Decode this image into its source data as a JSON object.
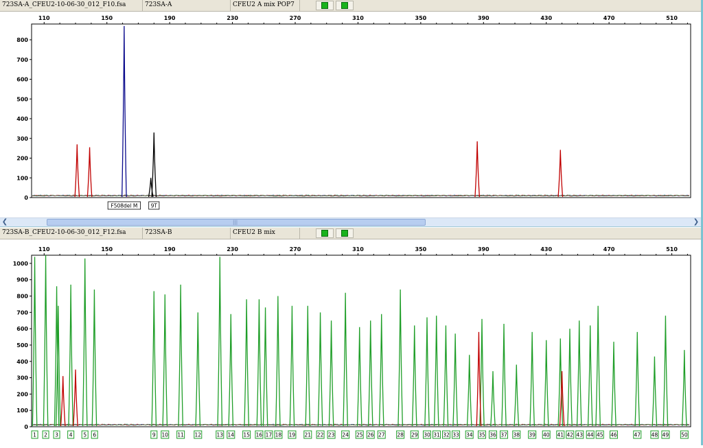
{
  "panels": [
    {
      "file": "723SA-A_CFEU2-10-06-30_012_F10.fsa",
      "sample": "723SA-A",
      "panel": "CFEU2 A mix POP7"
    },
    {
      "file": "723SA-B_CFEU2-10-06-30_012_F12.fsa",
      "sample": "723SA-B",
      "panel": "CFEU2 B mix"
    }
  ],
  "chart_data": [
    {
      "type": "line",
      "title": "",
      "xlabel": "",
      "ylabel": "",
      "xlim": [
        102,
        522
      ],
      "ylim": [
        0,
        880
      ],
      "x_ticks": [
        110,
        150,
        190,
        230,
        270,
        310,
        350,
        390,
        430,
        470,
        510
      ],
      "y_ticks": [
        0,
        100,
        200,
        300,
        400,
        500,
        600,
        700,
        800
      ],
      "grid": false,
      "series": [
        {
          "color": "#0a0a8c",
          "peaks": [
            {
              "x": 161,
              "y": 870
            }
          ]
        },
        {
          "color": "#000000",
          "peaks": [
            {
              "x": 180,
              "y": 330
            },
            {
              "x": 178,
              "y": 100
            }
          ]
        },
        {
          "color": "#c00000",
          "peaks": [
            {
              "x": 131,
              "y": 270
            },
            {
              "x": 139,
              "y": 255
            },
            {
              "x": 386,
              "y": 285
            },
            {
              "x": 439,
              "y": 242
            }
          ]
        }
      ],
      "annotations": [
        {
          "label": "F508del M",
          "x": 161
        },
        {
          "label": "9T",
          "x": 180
        }
      ]
    },
    {
      "type": "line",
      "title": "",
      "xlabel": "",
      "ylabel": "",
      "xlim": [
        102,
        522
      ],
      "ylim": [
        0,
        1050
      ],
      "x_ticks": [
        110,
        150,
        190,
        230,
        270,
        310,
        350,
        390,
        430,
        470,
        510
      ],
      "y_ticks": [
        0,
        100,
        200,
        300,
        400,
        500,
        600,
        700,
        800,
        900,
        1000
      ],
      "grid": false,
      "series": [
        {
          "color": "#1f9e28",
          "peaks": [
            {
              "x": 104,
              "y": 1040
            },
            {
              "x": 111,
              "y": 1050
            },
            {
              "x": 118,
              "y": 860
            },
            {
              "x": 119,
              "y": 740
            },
            {
              "x": 127,
              "y": 870
            },
            {
              "x": 136,
              "y": 1030
            },
            {
              "x": 142,
              "y": 840
            },
            {
              "x": 180,
              "y": 830
            },
            {
              "x": 187,
              "y": 810
            },
            {
              "x": 197,
              "y": 870
            },
            {
              "x": 208,
              "y": 700
            },
            {
              "x": 222,
              "y": 1040
            },
            {
              "x": 229,
              "y": 690
            },
            {
              "x": 239,
              "y": 780
            },
            {
              "x": 247,
              "y": 780
            },
            {
              "x": 251,
              "y": 730
            },
            {
              "x": 259,
              "y": 800
            },
            {
              "x": 268,
              "y": 740
            },
            {
              "x": 278,
              "y": 740
            },
            {
              "x": 286,
              "y": 700
            },
            {
              "x": 293,
              "y": 650
            },
            {
              "x": 302,
              "y": 820
            },
            {
              "x": 311,
              "y": 610
            },
            {
              "x": 318,
              "y": 650
            },
            {
              "x": 325,
              "y": 690
            },
            {
              "x": 337,
              "y": 840
            },
            {
              "x": 346,
              "y": 620
            },
            {
              "x": 354,
              "y": 670
            },
            {
              "x": 360,
              "y": 680
            },
            {
              "x": 366,
              "y": 620
            },
            {
              "x": 372,
              "y": 570
            },
            {
              "x": 381,
              "y": 440
            },
            {
              "x": 389,
              "y": 660
            },
            {
              "x": 396,
              "y": 340
            },
            {
              "x": 403,
              "y": 630
            },
            {
              "x": 411,
              "y": 380
            },
            {
              "x": 421,
              "y": 580
            },
            {
              "x": 430,
              "y": 530
            },
            {
              "x": 439,
              "y": 540
            },
            {
              "x": 445,
              "y": 600
            },
            {
              "x": 451,
              "y": 650
            },
            {
              "x": 458,
              "y": 620
            },
            {
              "x": 463,
              "y": 740
            },
            {
              "x": 473,
              "y": 520
            },
            {
              "x": 488,
              "y": 580
            },
            {
              "x": 499,
              "y": 430
            },
            {
              "x": 506,
              "y": 680
            },
            {
              "x": 518,
              "y": 470
            }
          ]
        },
        {
          "color": "#c00000",
          "peaks": [
            {
              "x": 122,
              "y": 310
            },
            {
              "x": 130,
              "y": 350
            },
            {
              "x": 387,
              "y": 580
            },
            {
              "x": 440,
              "y": 340
            }
          ]
        }
      ],
      "marker_labels": [
        "1",
        "2",
        "3",
        "4",
        "5",
        "6",
        "9",
        "10",
        "11",
        "12",
        "13",
        "14",
        "15",
        "16",
        "17",
        "18",
        "19",
        "21",
        "22",
        "23",
        "24",
        "25",
        "26",
        "27",
        "28",
        "29",
        "30",
        "31",
        "32",
        "33",
        "34",
        "35",
        "36",
        "37",
        "38",
        "39",
        "40",
        "41",
        "42",
        "43",
        "44",
        "45",
        "46",
        "47",
        "48",
        "49",
        "50"
      ]
    }
  ]
}
